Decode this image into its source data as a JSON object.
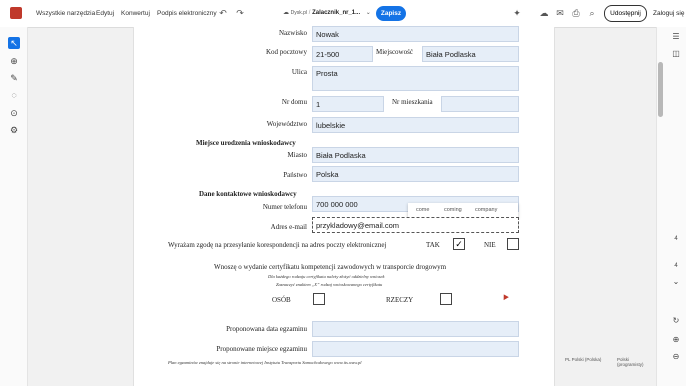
{
  "menu": {
    "all_tools": "Wszystkie narzędzia",
    "edit": "Edytuj",
    "convert": "Konwertuj",
    "sign": "Podpis elektroniczny"
  },
  "file": {
    "location": "Dysk.pl",
    "name": "Zalacznik_nr_1...",
    "save_label": "Zapisz"
  },
  "header": {
    "share_label": "Udostępnij",
    "login_label": "Zaloguj się"
  },
  "form": {
    "nazwisko_label": "Nazwisko",
    "nazwisko_value": "Nowak",
    "kod_label": "Kod pocztowy",
    "kod_value": "21-500",
    "miejscowosc_label": "Miejscowość",
    "miejscowosc_value": "Biała Podlaska",
    "ulica_label": "Ulica",
    "ulica_value": "Prosta",
    "nr_domu_label": "Nr domu",
    "nr_domu_value": "1",
    "nr_mieszkania_label": "Nr mieszkania",
    "nr_mieszkania_value": "",
    "wojewodztwo_label": "Województwo",
    "wojewodztwo_value": "lubelskie",
    "section_birthplace": "Miejsce urodzenia wnioskodawcy",
    "miasto_label": "Miasto",
    "miasto_value": "Biała Podlaska",
    "panstwo_label": "Państwo",
    "panstwo_value": "Polska",
    "section_contact": "Dane kontaktowe wnioskodawcy",
    "telefon_label": "Numer telefonu",
    "telefon_value": "700 000 000",
    "email_label": "Adres e-mail",
    "email_value": "przykladowy@email.com",
    "consent_text": "Wyrażam zgodę na przesyłanie korespondencji na adres poczty elektronicznej",
    "tak_label": "TAK",
    "tak_checked": "✓",
    "nie_label": "NIE",
    "cert_title": "Wnoszę o wydanie certyfikatu kompetencji zawodowych w transporcie drogowym",
    "cert_note1": "Dla każdego rodzaju certyfikatu należy złożyć oddzielny wniosek",
    "cert_note2": "Zaznaczyć znakiem „X” rodzaj wnioskowanego certyfikatu",
    "osob_label": "OSÓB",
    "rzeczy_label": "RZECZY",
    "exam_date_label": "Proponowana data egzaminu",
    "exam_date_value": "",
    "exam_place_label": "Proponowane miejsce egzaminu",
    "exam_place_value": "",
    "footer_note": "Plan egzaminów znajduje się na stronie internetowej Instytutu Transportu Samochodowego www.its.waw.pl"
  },
  "autocomplete": [
    "come",
    "coming",
    "company"
  ],
  "right_panel": {
    "page_current": "4",
    "page_total": "4"
  },
  "language_bar": {
    "lang1": "PL Polski (Polska)",
    "lang2": "Polski (programisty)"
  },
  "colors": {
    "accent": "#1473e6",
    "field_bg": "#e6eef8",
    "acrobat_red": "#c0392b"
  },
  "icons": {
    "undo": "↶",
    "redo": "↷",
    "cursor": "➤",
    "comment": "💬",
    "pen": "✎",
    "lasso": "◌",
    "search": "⌕",
    "stamp": "⚙",
    "cloud": "☁",
    "mail": "✉",
    "print": "⎙",
    "zoom": "🔍",
    "more": "⋯"
  }
}
